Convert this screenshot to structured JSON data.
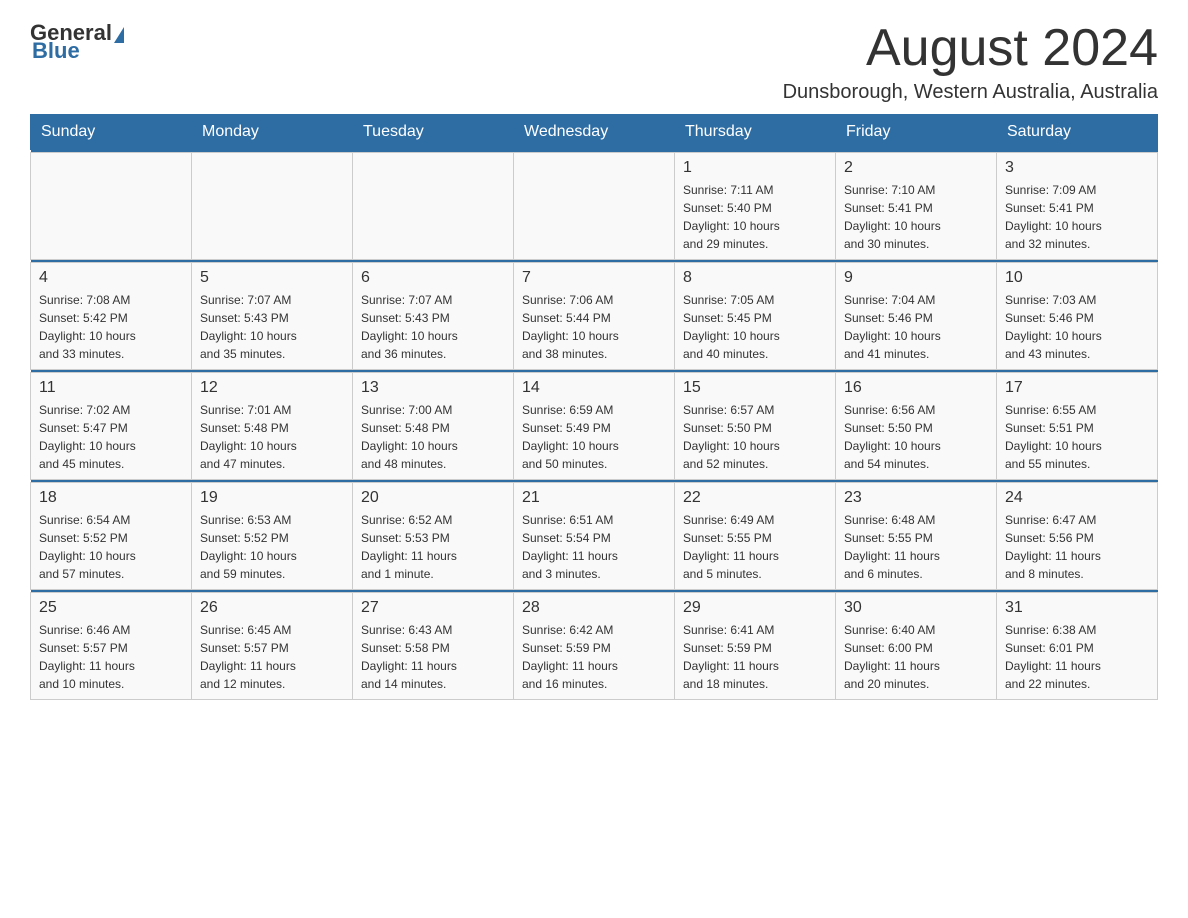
{
  "header": {
    "logo_general": "General",
    "logo_blue": "Blue",
    "month_title": "August 2024",
    "location": "Dunsborough, Western Australia, Australia"
  },
  "days_of_week": [
    "Sunday",
    "Monday",
    "Tuesday",
    "Wednesday",
    "Thursday",
    "Friday",
    "Saturday"
  ],
  "weeks": [
    {
      "days": [
        {
          "number": "",
          "info": ""
        },
        {
          "number": "",
          "info": ""
        },
        {
          "number": "",
          "info": ""
        },
        {
          "number": "",
          "info": ""
        },
        {
          "number": "1",
          "info": "Sunrise: 7:11 AM\nSunset: 5:40 PM\nDaylight: 10 hours\nand 29 minutes."
        },
        {
          "number": "2",
          "info": "Sunrise: 7:10 AM\nSunset: 5:41 PM\nDaylight: 10 hours\nand 30 minutes."
        },
        {
          "number": "3",
          "info": "Sunrise: 7:09 AM\nSunset: 5:41 PM\nDaylight: 10 hours\nand 32 minutes."
        }
      ]
    },
    {
      "days": [
        {
          "number": "4",
          "info": "Sunrise: 7:08 AM\nSunset: 5:42 PM\nDaylight: 10 hours\nand 33 minutes."
        },
        {
          "number": "5",
          "info": "Sunrise: 7:07 AM\nSunset: 5:43 PM\nDaylight: 10 hours\nand 35 minutes."
        },
        {
          "number": "6",
          "info": "Sunrise: 7:07 AM\nSunset: 5:43 PM\nDaylight: 10 hours\nand 36 minutes."
        },
        {
          "number": "7",
          "info": "Sunrise: 7:06 AM\nSunset: 5:44 PM\nDaylight: 10 hours\nand 38 minutes."
        },
        {
          "number": "8",
          "info": "Sunrise: 7:05 AM\nSunset: 5:45 PM\nDaylight: 10 hours\nand 40 minutes."
        },
        {
          "number": "9",
          "info": "Sunrise: 7:04 AM\nSunset: 5:46 PM\nDaylight: 10 hours\nand 41 minutes."
        },
        {
          "number": "10",
          "info": "Sunrise: 7:03 AM\nSunset: 5:46 PM\nDaylight: 10 hours\nand 43 minutes."
        }
      ]
    },
    {
      "days": [
        {
          "number": "11",
          "info": "Sunrise: 7:02 AM\nSunset: 5:47 PM\nDaylight: 10 hours\nand 45 minutes."
        },
        {
          "number": "12",
          "info": "Sunrise: 7:01 AM\nSunset: 5:48 PM\nDaylight: 10 hours\nand 47 minutes."
        },
        {
          "number": "13",
          "info": "Sunrise: 7:00 AM\nSunset: 5:48 PM\nDaylight: 10 hours\nand 48 minutes."
        },
        {
          "number": "14",
          "info": "Sunrise: 6:59 AM\nSunset: 5:49 PM\nDaylight: 10 hours\nand 50 minutes."
        },
        {
          "number": "15",
          "info": "Sunrise: 6:57 AM\nSunset: 5:50 PM\nDaylight: 10 hours\nand 52 minutes."
        },
        {
          "number": "16",
          "info": "Sunrise: 6:56 AM\nSunset: 5:50 PM\nDaylight: 10 hours\nand 54 minutes."
        },
        {
          "number": "17",
          "info": "Sunrise: 6:55 AM\nSunset: 5:51 PM\nDaylight: 10 hours\nand 55 minutes."
        }
      ]
    },
    {
      "days": [
        {
          "number": "18",
          "info": "Sunrise: 6:54 AM\nSunset: 5:52 PM\nDaylight: 10 hours\nand 57 minutes."
        },
        {
          "number": "19",
          "info": "Sunrise: 6:53 AM\nSunset: 5:52 PM\nDaylight: 10 hours\nand 59 minutes."
        },
        {
          "number": "20",
          "info": "Sunrise: 6:52 AM\nSunset: 5:53 PM\nDaylight: 11 hours\nand 1 minute."
        },
        {
          "number": "21",
          "info": "Sunrise: 6:51 AM\nSunset: 5:54 PM\nDaylight: 11 hours\nand 3 minutes."
        },
        {
          "number": "22",
          "info": "Sunrise: 6:49 AM\nSunset: 5:55 PM\nDaylight: 11 hours\nand 5 minutes."
        },
        {
          "number": "23",
          "info": "Sunrise: 6:48 AM\nSunset: 5:55 PM\nDaylight: 11 hours\nand 6 minutes."
        },
        {
          "number": "24",
          "info": "Sunrise: 6:47 AM\nSunset: 5:56 PM\nDaylight: 11 hours\nand 8 minutes."
        }
      ]
    },
    {
      "days": [
        {
          "number": "25",
          "info": "Sunrise: 6:46 AM\nSunset: 5:57 PM\nDaylight: 11 hours\nand 10 minutes."
        },
        {
          "number": "26",
          "info": "Sunrise: 6:45 AM\nSunset: 5:57 PM\nDaylight: 11 hours\nand 12 minutes."
        },
        {
          "number": "27",
          "info": "Sunrise: 6:43 AM\nSunset: 5:58 PM\nDaylight: 11 hours\nand 14 minutes."
        },
        {
          "number": "28",
          "info": "Sunrise: 6:42 AM\nSunset: 5:59 PM\nDaylight: 11 hours\nand 16 minutes."
        },
        {
          "number": "29",
          "info": "Sunrise: 6:41 AM\nSunset: 5:59 PM\nDaylight: 11 hours\nand 18 minutes."
        },
        {
          "number": "30",
          "info": "Sunrise: 6:40 AM\nSunset: 6:00 PM\nDaylight: 11 hours\nand 20 minutes."
        },
        {
          "number": "31",
          "info": "Sunrise: 6:38 AM\nSunset: 6:01 PM\nDaylight: 11 hours\nand 22 minutes."
        }
      ]
    }
  ]
}
